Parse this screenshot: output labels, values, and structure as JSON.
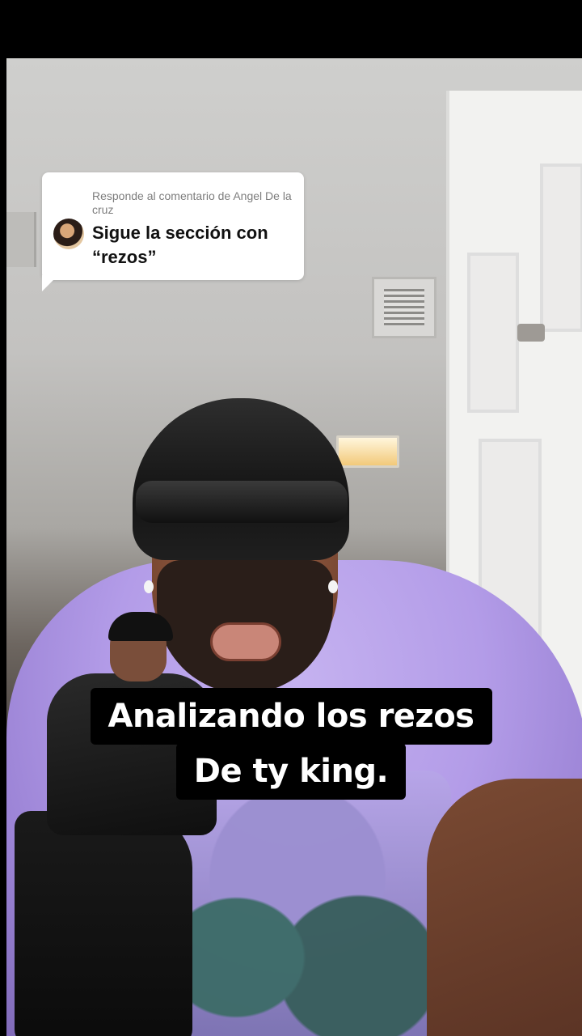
{
  "comment_bubble": {
    "reply_label": "Responde al comentario de Angel De la cruz",
    "comment_text": "Sigue la sección con “rezos”"
  },
  "caption": {
    "line1": "Analizando los rezos",
    "line2": "De ty king."
  },
  "colors": {
    "shirt": "#b39ce8",
    "caption_bg": "#000000",
    "caption_text": "#ffffff",
    "bubble_bg": "#ffffff"
  }
}
